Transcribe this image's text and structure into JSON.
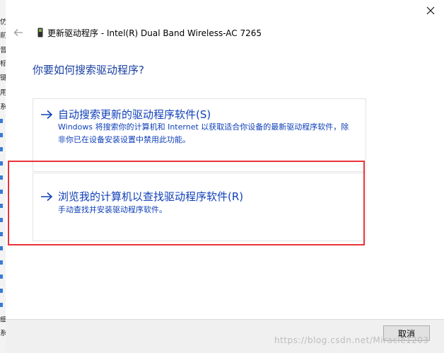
{
  "background_window": {
    "visible_chars": [
      "仿",
      "前",
      "音",
      "标",
      "键",
      "用",
      "系",
      "细",
      "系"
    ]
  },
  "dialog": {
    "title": "更新驱动程序 - Intel(R) Dual Band Wireless-AC 7265",
    "question": "你要如何搜索驱动程序?",
    "options": [
      {
        "title": "自动搜索更新的驱动程序软件(S)",
        "description": "Windows 将搜索你的计算机和 Internet 以获取适合你设备的最新驱动程序软件，除非你已在设备安装设置中禁用此功能。"
      },
      {
        "title": "浏览我的计算机以查找驱动程序软件(R)",
        "description": "手动查找并安装驱动程序软件。"
      }
    ],
    "cancel_label": "取消"
  },
  "watermark": "https://blog.csdn.net/Miracle1203",
  "icons": {
    "close": "close-icon",
    "back": "back-arrow-icon",
    "device": "device-icon",
    "option_arrow": "right-arrow-icon"
  },
  "colors": {
    "link_blue": "#1040b8",
    "question_blue": "#1a3fa0",
    "highlight_red": "#e8333a"
  }
}
